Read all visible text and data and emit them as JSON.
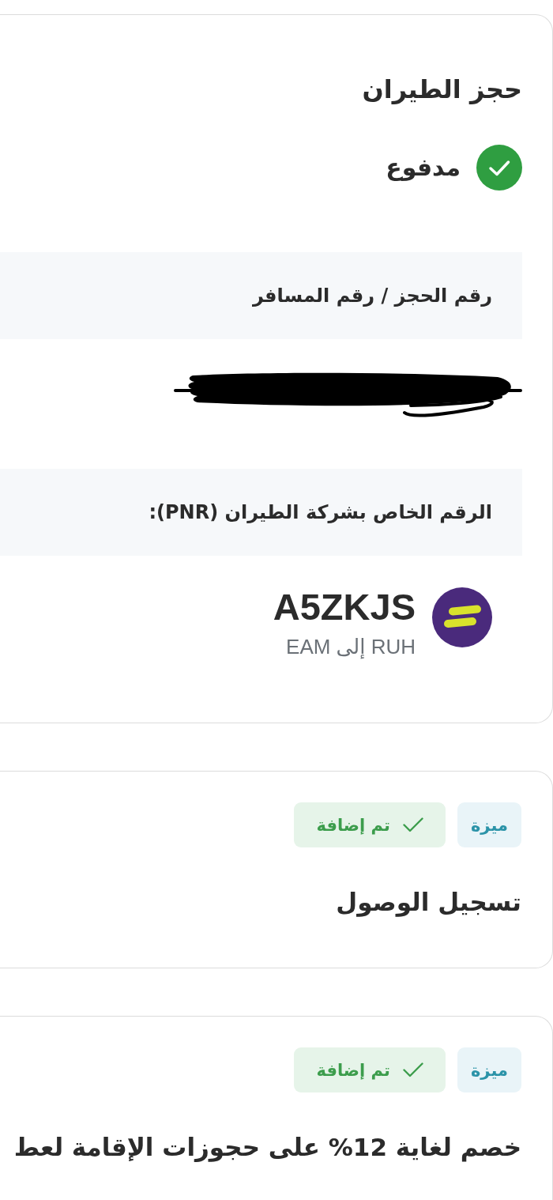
{
  "booking": {
    "title": "حجز الطيران",
    "payment": {
      "label": "مدفوع",
      "paid": true
    },
    "booking_number": {
      "label": "رقم الحجز / رقم المسافر",
      "redacted": true
    },
    "airline": {
      "label": "الرقم الخاص بشركة الطيران (PNR):",
      "pnr": "A5ZKJS",
      "route": "RUH إلى EAM"
    }
  },
  "features": [
    {
      "tag": "ميزة",
      "status": "تم إضافة",
      "added": true,
      "title": "تسجيل الوصول"
    },
    {
      "tag": "ميزة",
      "status": "تم إضافة",
      "added": true,
      "title": "خصم لغاية 12% على حجوزات الإقامة لعط"
    }
  ]
}
